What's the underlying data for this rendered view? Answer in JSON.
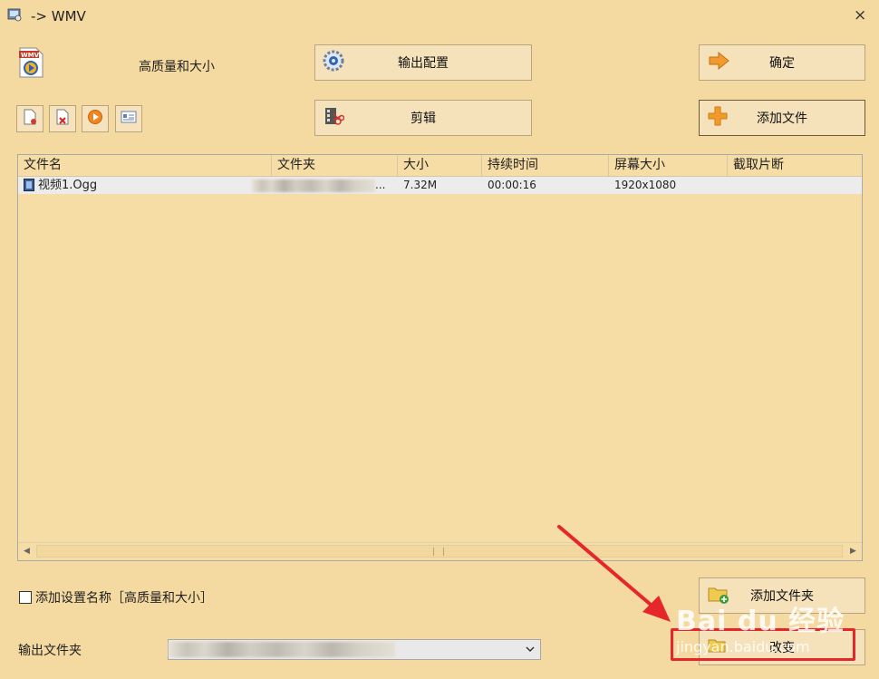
{
  "window": {
    "title": "-> WMV",
    "close_glyph": "×"
  },
  "profile": {
    "format_badge": "WMV",
    "quality_label": "高质量和大小"
  },
  "buttons": {
    "output_config": "输出配置",
    "ok": "确定",
    "edit": "剪辑",
    "add_file": "添加文件",
    "add_folder": "添加文件夹",
    "change": "改变"
  },
  "toolbar": {
    "icons": [
      "new-file-icon",
      "delete-file-icon",
      "play-icon",
      "info-card-icon"
    ]
  },
  "file_list": {
    "columns": [
      "文件名",
      "文件夹",
      "大小",
      "持续时间",
      "屏幕大小",
      "截取片断"
    ],
    "rows": [
      {
        "name": "视频1.Ogg",
        "folder_suffix": "...",
        "size": "7.32M",
        "duration": "00:00:16",
        "screen_size": "1920x1080",
        "clip": ""
      }
    ]
  },
  "options": {
    "add_setting_name_checked": false,
    "add_setting_name_label": "添加设置名称［高质量和大小］"
  },
  "output": {
    "label": "输出文件夹"
  },
  "watermark": {
    "brand": "Bai du 经验",
    "url": "jingyan.baidu.com"
  },
  "colors": {
    "background": "#f4d9a0",
    "annotation_red": "#e5262b"
  }
}
